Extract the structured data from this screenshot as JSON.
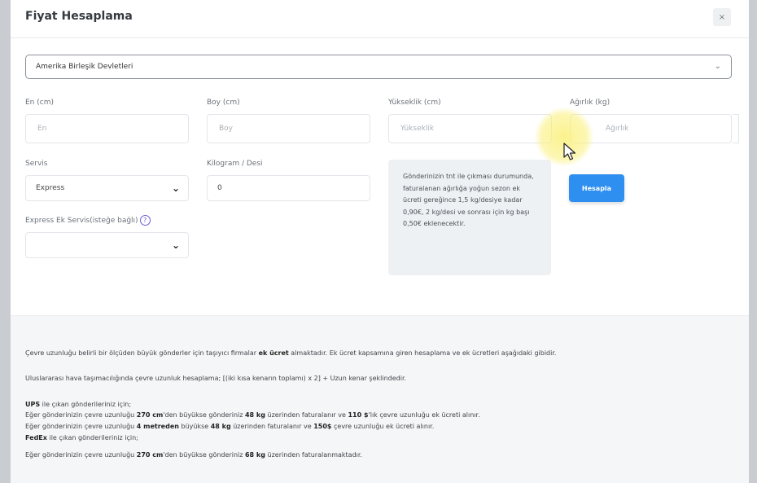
{
  "modal": {
    "title": "Fiyat Hesaplama",
    "close_label": "×"
  },
  "country": {
    "selected": "Amerika Birleşik Devletleri"
  },
  "dimensions": {
    "width_label": "En (cm)",
    "width_placeholder": "En",
    "length_label": "Boy (cm)",
    "length_placeholder": "Boy",
    "height_label": "Yükseklik (cm)",
    "height_placeholder": "Yükseklik",
    "weight_label": "Ağırlık (kg)",
    "weight_placeholder": "Ağırlık"
  },
  "service": {
    "label": "Servis",
    "selected": "Express",
    "desi_label": "Kilogram / Desi",
    "desi_value": "0",
    "extra_label": "Express Ek Servis(isteğe bağlı)",
    "extra_selected": ""
  },
  "tooltip": {
    "text": "Gönderinizin tnt ile çıkması durumunda, faturalanan ağırlığa yoğun sezon ek ücreti gereğince 1,5 kg/desiye kadar 0,90€, 2 kg/desi ve sonrası için kg başı 0,50€ eklenecektir."
  },
  "actions": {
    "calculate_label": "Hesapla"
  },
  "footer": {
    "line1_pre": "Çevre uzunluğu belirli bir ölçüden büyük gönderler için taşıyıcı firmalar ",
    "line1_bold": "ek ücret",
    "line1_post": " almaktadır. Ek ücret kapsamına giren hesaplama ve ek ücretleri aşağıdaki gibidir.",
    "line2": "Uluslararası hava taşımacılığında çevre uzunluk hesaplama; [(iki kısa kenarın toplamı) x 2] + Uzun kenar şeklindedir.",
    "ups_title": "UPS",
    "ups_title_post": " ile çıkan gönderileriniz için;",
    "ups_rule1_a": "Eğer gönderinizin çevre uzunluğu ",
    "ups_rule1_b": "270 cm",
    "ups_rule1_c": "'den büyükse gönderiniz ",
    "ups_rule1_d": "48 kg",
    "ups_rule1_e": " üzerinden faturalanır ve ",
    "ups_rule1_f": "110 $",
    "ups_rule1_g": "'lık çevre uzunluğu ek ücreti alınır.",
    "ups_rule2_a": "Eğer gönderinizin çevre uzunluğu ",
    "ups_rule2_b": "4 metreden",
    "ups_rule2_c": " büyükse ",
    "ups_rule2_d": "48 kg",
    "ups_rule2_e": " üzerinden faturalanır ve ",
    "ups_rule2_f": "150$",
    "ups_rule2_g": " çevre uzunluğu ek ücreti alınır.",
    "fedex_title": "FedEx",
    "fedex_title_post": " ile çıkan gönderileriniz için;",
    "fedex_rule_a": "Eğer gönderinizin çevre uzunluğu ",
    "fedex_rule_b": "270 cm",
    "fedex_rule_c": "'den büyükse gönderiniz ",
    "fedex_rule_d": "68 kg",
    "fedex_rule_e": " üzerinden faturalanmaktadır."
  },
  "colors": {
    "primary": "#2f8ff0",
    "help_icon": "#6b5cd6"
  }
}
